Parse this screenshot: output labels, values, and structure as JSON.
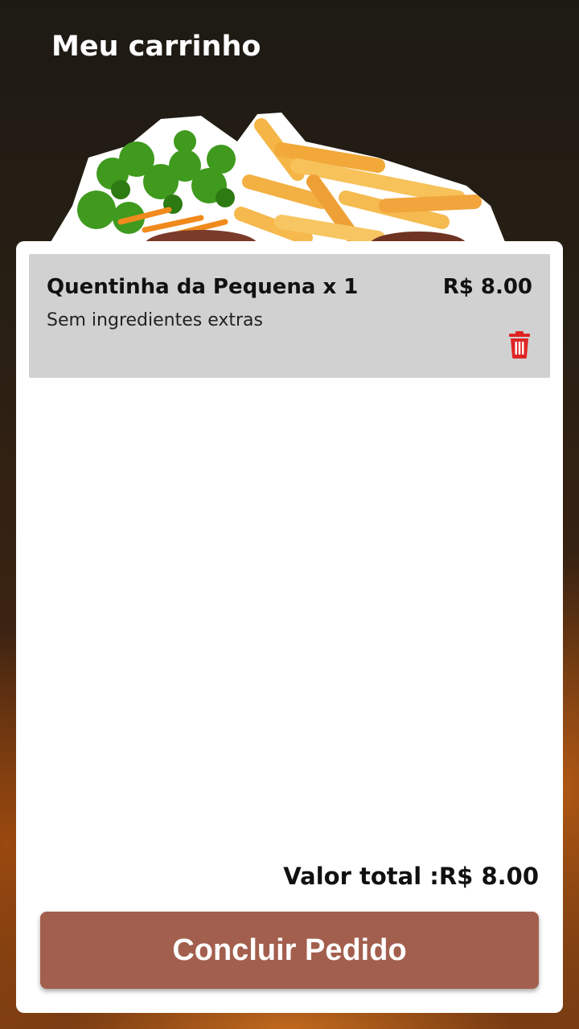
{
  "header": {
    "title": "Meu carrinho"
  },
  "cart": {
    "items": [
      {
        "name": "Quentinha da Pequena x 1",
        "price": "R$ 8.00",
        "description": "Sem ingredientes extras",
        "delete_icon": "trash-icon"
      }
    ],
    "total_label": "Valor total :R$ 8.00",
    "confirm_label": "Concluir Pedido"
  },
  "colors": {
    "accent": "#a35f4e",
    "delete": "#e02424",
    "item_background": "#d1d1d1"
  }
}
